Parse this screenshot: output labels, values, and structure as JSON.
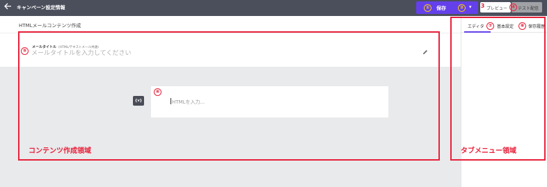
{
  "header": {
    "title": "キャンペーン設定情報",
    "save_label": "保存",
    "preview_label": "プレビュー",
    "test_label": "テスト配信"
  },
  "main": {
    "page_title": "HTMLメールコンテンツ作成",
    "mail_title_label": "メールタイトル",
    "mail_title_sub": "(HTML/テキストメール共通)",
    "mail_title_placeholder": "メールタイトルを入力してください",
    "var_button": "{v}",
    "html_placeholder": "HTMLを入力..."
  },
  "panel": {
    "tabs": [
      {
        "label": "エディタ"
      },
      {
        "label": "基本設定"
      },
      {
        "label": "保存履歴"
      }
    ]
  },
  "annotations": {
    "content_area": "コンテンツ作成領域",
    "tab_area": "タブメニュー領域",
    "n1": "①",
    "n2": "②",
    "n3": "3",
    "n4": "④",
    "n5": "⑤",
    "n6": "⑥",
    "n7": "⑦",
    "n8": "⑧"
  },
  "colors": {
    "topbar": "#4b4f5c",
    "accent": "#6440ea",
    "annotation": "#e8213a",
    "number_badge": "#f5c518"
  }
}
